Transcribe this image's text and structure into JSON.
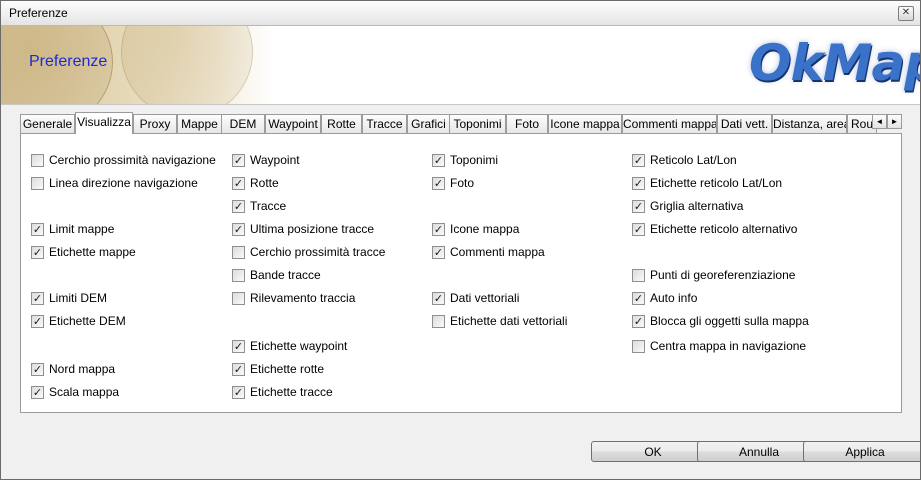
{
  "window": {
    "title": "Preferenze",
    "close_symbol": "✕"
  },
  "banner": {
    "title": "Preferenze",
    "logo_text": "OkMap"
  },
  "tabs": [
    "Generale",
    "Visualizza",
    "Proxy",
    "Mappe",
    "DEM",
    "Waypoint",
    "Rotte",
    "Tracce",
    "Grafici",
    "Toponimi",
    "Foto",
    "Icone mappa",
    "Commenti mappa",
    "Dati vett.",
    "Distanza, area",
    "Rou"
  ],
  "active_tab": "Visualizza",
  "tab_scroll": {
    "left": "◄",
    "right": "►"
  },
  "options": {
    "col1": [
      {
        "label": "Cerchio prossimità navigazione",
        "checked": false
      },
      {
        "label": "Linea direzione navigazione",
        "checked": false
      },
      {
        "label": "Limit mappe",
        "checked": true
      },
      {
        "label": "Etichette mappe",
        "checked": true
      },
      {
        "label": "Limiti DEM",
        "checked": true
      },
      {
        "label": "Etichette DEM",
        "checked": true
      },
      {
        "label": "Nord mappa",
        "checked": true
      },
      {
        "label": "Scala mappa",
        "checked": true
      }
    ],
    "col2": [
      {
        "label": "Waypoint",
        "checked": true
      },
      {
        "label": "Rotte",
        "checked": true
      },
      {
        "label": "Tracce",
        "checked": true
      },
      {
        "label": "Ultima posizione tracce",
        "checked": true
      },
      {
        "label": "Cerchio prossimità tracce",
        "checked": false
      },
      {
        "label": "Bande tracce",
        "checked": false
      },
      {
        "label": "Rilevamento traccia",
        "checked": false
      },
      {
        "label": "Etichette waypoint",
        "checked": true
      },
      {
        "label": "Etichette rotte",
        "checked": true
      },
      {
        "label": "Etichette tracce",
        "checked": true
      }
    ],
    "col3": [
      {
        "label": "Toponimi",
        "checked": true
      },
      {
        "label": "Foto",
        "checked": true
      },
      {
        "label": "Icone mappa",
        "checked": true
      },
      {
        "label": "Commenti mappa",
        "checked": true
      },
      {
        "label": "Dati vettoriali",
        "checked": true
      },
      {
        "label": "Etichette dati vettoriali",
        "checked": false
      }
    ],
    "col4": [
      {
        "label": "Reticolo Lat/Lon",
        "checked": true
      },
      {
        "label": "Etichette reticolo Lat/Lon",
        "checked": true
      },
      {
        "label": "Griglia alternativa",
        "checked": true
      },
      {
        "label": "Etichette reticolo alternativo",
        "checked": true
      },
      {
        "label": "Punti di georeferenziazione",
        "checked": false
      },
      {
        "label": "Auto info",
        "checked": true
      },
      {
        "label": "Blocca gli oggetti sulla mappa",
        "checked": true
      },
      {
        "label": "Centra mappa in navigazione",
        "checked": false
      }
    ]
  },
  "buttons": {
    "ok": "OK",
    "cancel": "Annulla",
    "apply": "Applica"
  }
}
